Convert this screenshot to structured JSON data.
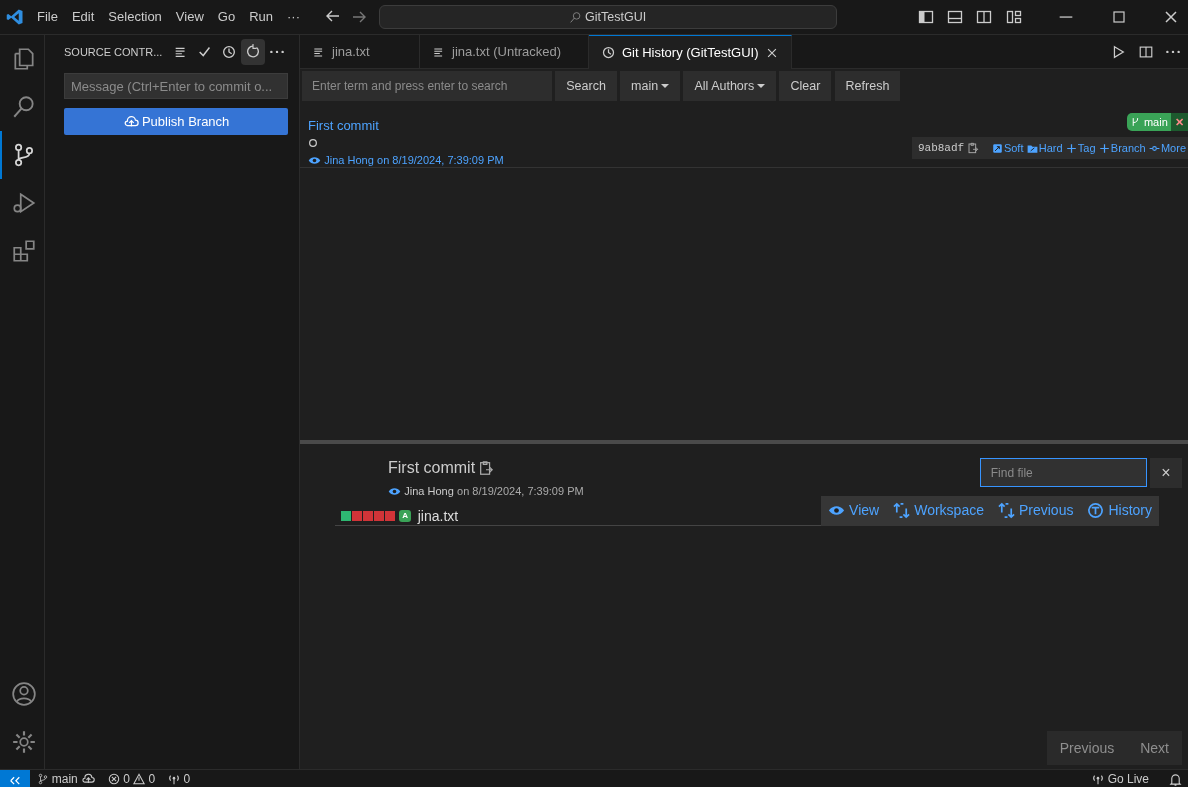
{
  "title_bar": {
    "menus": [
      "File",
      "Edit",
      "Selection",
      "View",
      "Go",
      "Run",
      "···"
    ],
    "command_center": "GitTestGUI"
  },
  "activity_bar": {
    "items": [
      {
        "kind": "explorer",
        "selected": false
      },
      {
        "kind": "search",
        "selected": false
      },
      {
        "kind": "source-control",
        "selected": true
      },
      {
        "kind": "run",
        "selected": false
      },
      {
        "kind": "extensions",
        "selected": false
      }
    ]
  },
  "sidebar": {
    "title": "SOURCE CONTR...",
    "message": {
      "placeholder": "Message (Ctrl+Enter to commit o..."
    },
    "publish_button": "Publish Branch"
  },
  "tabs": [
    {
      "label": "jina.txt",
      "kind": "file",
      "selected": false
    },
    {
      "label": "jina.txt (Untracked)",
      "kind": "file",
      "selected": false
    },
    {
      "label": "Git History (GitTestGUI)",
      "kind": "history",
      "selected": true
    }
  ],
  "toolbar": {
    "search": {
      "placeholder": "Enter term and press enter to search"
    },
    "buttons": [
      {
        "label": "Search",
        "dropdown": false
      },
      {
        "label": "main",
        "dropdown": true
      },
      {
        "label": "All Authors",
        "dropdown": true
      },
      {
        "label": "Clear",
        "dropdown": false
      },
      {
        "label": "Refresh",
        "dropdown": false
      }
    ]
  },
  "commits": [
    {
      "title": "First commit",
      "author": "Jina Hong",
      "date": "on 8/19/2024, 7:39:09 PM",
      "hash": "9ab8adf",
      "branch": "main",
      "remove": "✕",
      "actions": [
        "Soft",
        "Hard",
        "Tag",
        "Branch",
        "More"
      ]
    }
  ],
  "details": {
    "title": "First commit",
    "author": "Jina Hong",
    "date": "on 8/19/2024, 7:39:09 PM",
    "find_file": {
      "placeholder": "Find file"
    },
    "close": "×",
    "files": [
      {
        "name": "jina.txt",
        "status": "A",
        "blocks": [
          {
            "color": "#2eb872"
          },
          {
            "color": "#d13438"
          },
          {
            "color": "#d13438"
          },
          {
            "color": "#d13438"
          },
          {
            "color": "#d13438"
          }
        ],
        "actions": [
          "View",
          "Workspace",
          "Previous",
          "History"
        ]
      }
    ]
  },
  "pagination": [
    {
      "label": "Previous"
    },
    {
      "label": "Next"
    }
  ],
  "status_bar": {
    "branch": "main",
    "errors": "0",
    "warnings": "0",
    "ports": "0",
    "go_live": "Go Live"
  }
}
